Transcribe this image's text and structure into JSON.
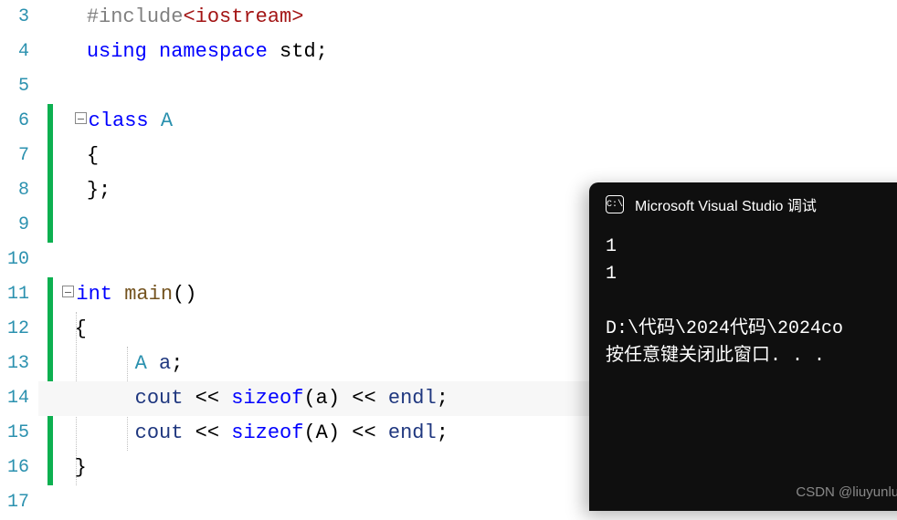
{
  "gutter": {
    "lines": [
      "3",
      "4",
      "5",
      "6",
      "7",
      "8",
      "9",
      "10",
      "11",
      "12",
      "13",
      "14",
      "15",
      "16",
      "17"
    ]
  },
  "code": {
    "l3": {
      "preproc": "#include",
      "header": "<iostream>"
    },
    "l4": {
      "kw_using": "using",
      "kw_namespace": "namespace",
      "ident": " std",
      "semi": ";"
    },
    "l6": {
      "kw_class": "class",
      "name": " A"
    },
    "l7": {
      "brace": "{"
    },
    "l8": {
      "brace": "};"
    },
    "l11": {
      "type": "int",
      "func": " main",
      "paren": "()"
    },
    "l12": {
      "brace": "{"
    },
    "l13": {
      "type": "A",
      "var": " a",
      "semi": ";"
    },
    "l14": {
      "ident": "cout",
      "op1": " << ",
      "kw": "sizeof",
      "arg": "(a)",
      "op2": " << ",
      "endl": "endl",
      "semi": ";"
    },
    "l15": {
      "ident": "cout",
      "op1": " << ",
      "kw": "sizeof",
      "arg": "(A)",
      "op2": " << ",
      "endl": "endl",
      "semi": ";"
    },
    "l16": {
      "brace": "}"
    }
  },
  "console": {
    "title": "Microsoft Visual Studio 调试",
    "icon_text": "C:\\",
    "output": "1\n1\n\nD:\\代码\\2024代码\\2024co\n按任意键关闭此窗口. . ."
  },
  "watermark": "CSDN @liuyunluoxiao"
}
